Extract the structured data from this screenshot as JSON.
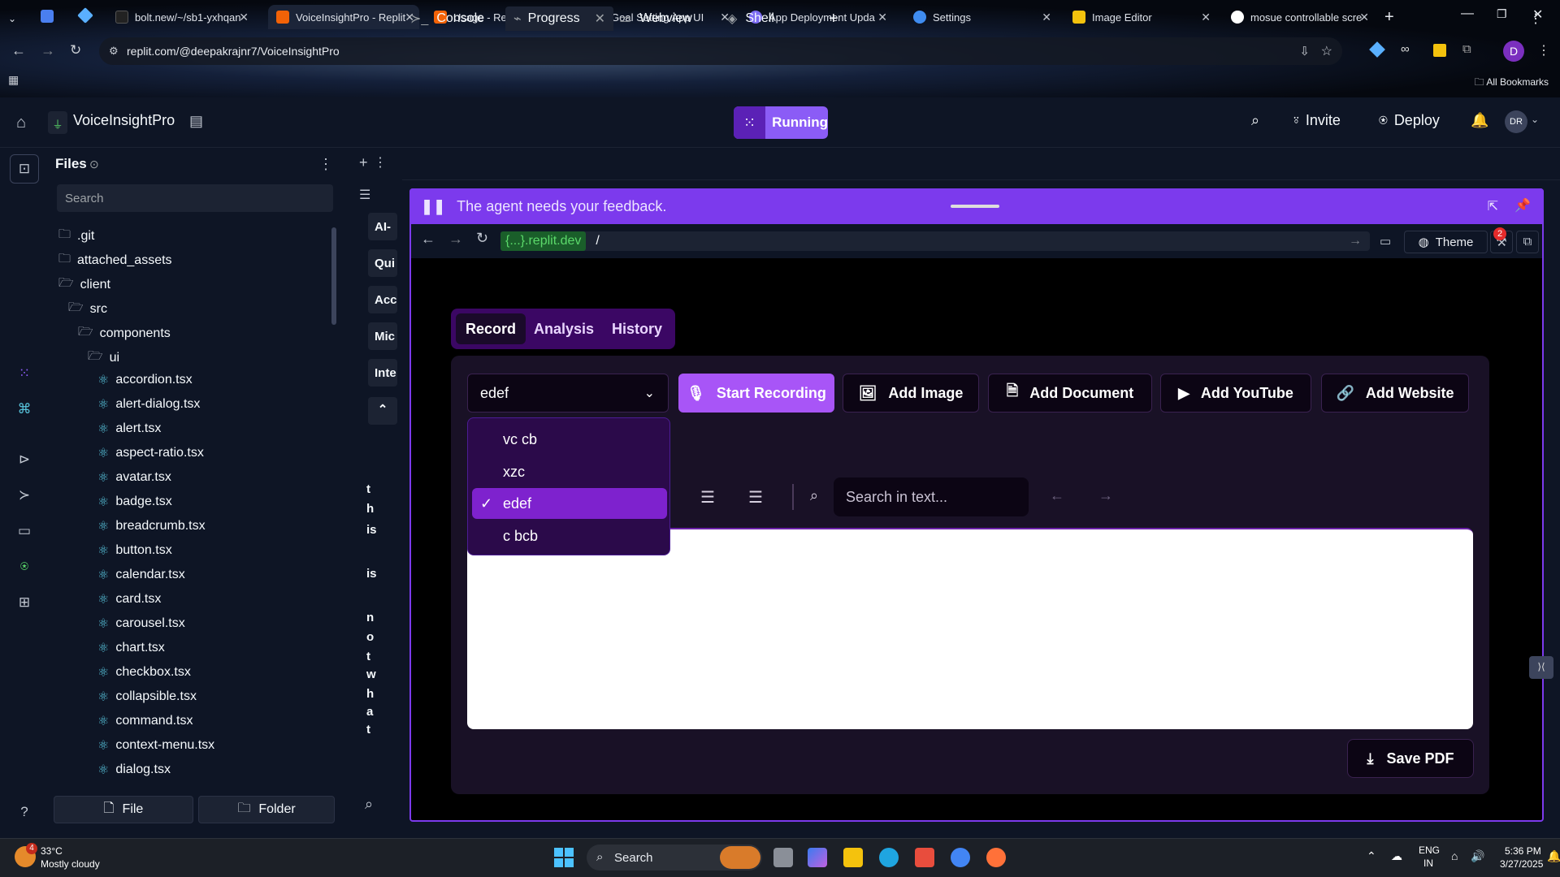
{
  "browser": {
    "tabs": [
      {
        "title": "bolt.new/~/sb1-yxhqan",
        "color": "#101010"
      },
      {
        "title": "VoiceInsightPro - Replit",
        "color": "#f26207"
      },
      {
        "title": "Usage - Replit",
        "color": "#f26207"
      },
      {
        "title": "Goal Setting App UI",
        "color": "#ffffff"
      },
      {
        "title": "App Deployment Upda",
        "color": "#7c6cf2"
      },
      {
        "title": "Settings",
        "color": "#3f8cf0"
      },
      {
        "title": "Image Editor",
        "color": "#f4c20d"
      },
      {
        "title": "mosue controllable scre",
        "color": "#4285f4"
      }
    ],
    "url": "replit.com/@deepakrajnr7/VoiceInsightPro",
    "bookmarks_label": "All Bookmarks",
    "profile_initial": "D"
  },
  "replit": {
    "project_name": "VoiceInsightPro",
    "run_status": "Running",
    "invite_label": "Invite",
    "deploy_label": "Deploy",
    "avatar_initials": "DR"
  },
  "files": {
    "title": "Files",
    "search_placeholder": "Search",
    "folders": [
      ".git",
      "attached_assets",
      "client",
      "src",
      "components",
      "ui"
    ],
    "ui_files": [
      "accordion.tsx",
      "alert-dialog.tsx",
      "alert.tsx",
      "aspect-ratio.tsx",
      "avatar.tsx",
      "badge.tsx",
      "breadcrumb.tsx",
      "button.tsx",
      "calendar.tsx",
      "card.tsx",
      "carousel.tsx",
      "chart.tsx",
      "checkbox.tsx",
      "collapsible.tsx",
      "command.tsx",
      "context-menu.tsx",
      "dialog.tsx"
    ],
    "new_file_label": "File",
    "new_folder_label": "Folder"
  },
  "middle": {
    "snippets": [
      "AI-",
      "Qui",
      "Acc",
      "Mic",
      "Inte"
    ],
    "vertical_text": [
      "t",
      "h",
      "is",
      "is",
      "n",
      "o",
      "t",
      "w",
      "h",
      "a",
      "t"
    ]
  },
  "workspace_tabs": [
    "Console",
    "Progress",
    "Webview",
    "Shell"
  ],
  "webview": {
    "banner": "The agent needs your feedback.",
    "domain": "{...}.replit.dev",
    "path": "/",
    "theme_label": "Theme",
    "notif_count": "2"
  },
  "app": {
    "mode_tabs": [
      "Record",
      "Analysis",
      "History"
    ],
    "select_value": "edef",
    "actions": {
      "start_recording": "Start Recording",
      "add_image": "Add Image",
      "add_document": "Add Document",
      "add_youtube": "Add YouTube",
      "add_website": "Add Website"
    },
    "dropdown_options": [
      "vc cb",
      "xzc",
      "edef",
      "c bcb"
    ],
    "selected_option": "edef",
    "search_placeholder": "Search in text...",
    "save_pdf": "Save PDF"
  },
  "taskbar": {
    "weather_temp": "33°C",
    "weather_desc": "Mostly cloudy",
    "weather_badge": "4",
    "search_label": "Search",
    "lang": "ENG",
    "region": "IN",
    "time": "5:36 PM",
    "date": "3/27/2025"
  }
}
